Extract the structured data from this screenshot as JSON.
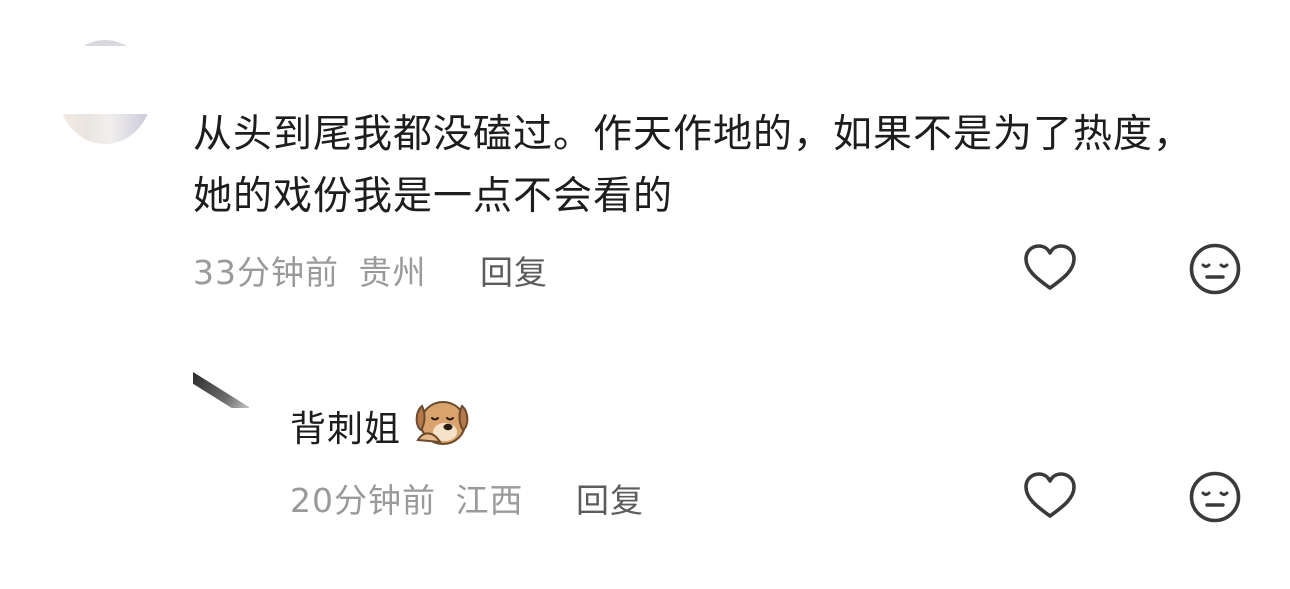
{
  "comment": {
    "text_line1": "从头到尾我都没磕过。作天作地的，如果不是为了热度，",
    "text_line2": "她的戏份我是一点不会看的",
    "time": "33分钟前",
    "location": "贵州",
    "reply_label": "回复",
    "like_icon": "heart-outline-icon",
    "dislike_icon": "neutral-face-icon"
  },
  "reply": {
    "username": "背刺姐",
    "username_emoji": "dog-emoji",
    "time": "20分钟前",
    "location": "江西",
    "reply_label": "回复",
    "like_icon": "heart-outline-icon",
    "dislike_icon": "neutral-face-icon"
  },
  "colors": {
    "text_primary": "#1d1d1d",
    "text_meta": "#9a9a9a",
    "reply_label": "#5c5c5c",
    "icon_stroke": "#3a3a3a"
  }
}
